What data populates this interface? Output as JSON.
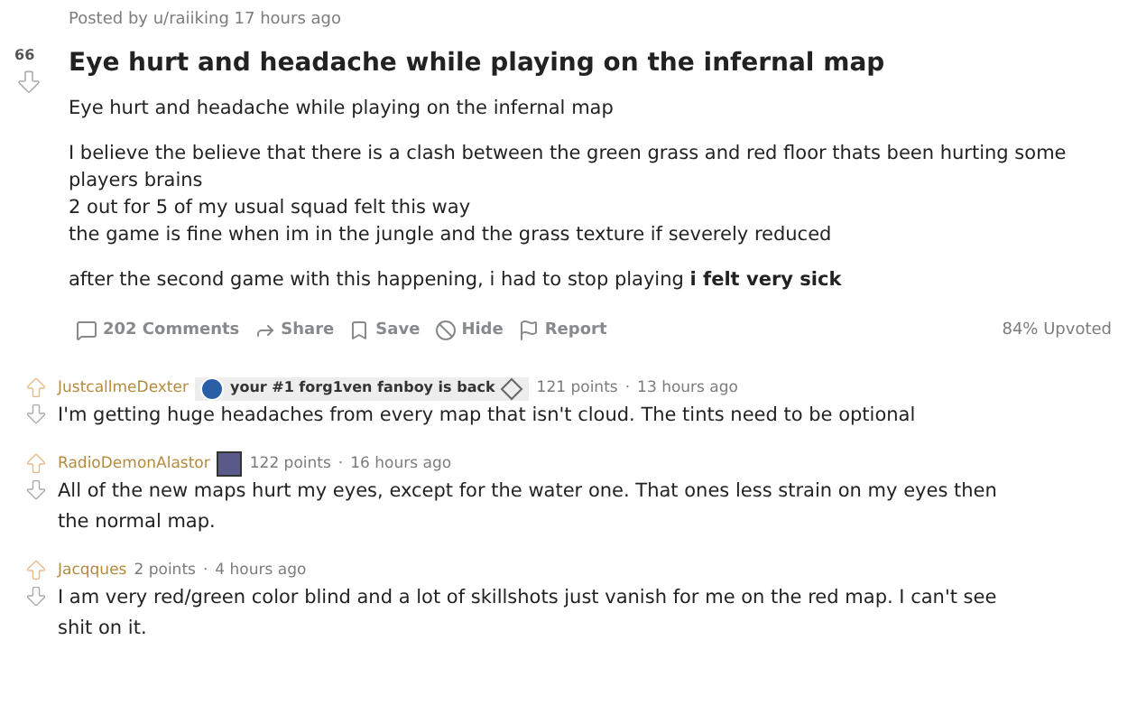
{
  "post": {
    "meta": "Posted by u/raiiking 17 hours ago",
    "score": "66",
    "title": "Eye hurt and headache while playing on the infernal map",
    "paragraphs": [
      [
        "Eye hurt and headache while playing on the infernal map"
      ],
      [
        "I believe the believe that there is a clash between the green grass and red floor thats been hurting some players brains",
        "2 out for 5 of my usual squad felt this way",
        "the game is fine when im in the jungle and the grass texture if severely reduced"
      ],
      [
        "after the second game with this happening, i had to stop playing **i felt very sick**"
      ]
    ],
    "actions": [
      {
        "kind": "comments",
        "label": "202 Comments"
      },
      {
        "kind": "share",
        "label": "Share"
      },
      {
        "kind": "save",
        "label": "Save"
      },
      {
        "kind": "hide",
        "label": "Hide"
      },
      {
        "kind": "report",
        "label": "Report"
      }
    ],
    "upvoted": "84% Upvoted"
  },
  "comments": [
    {
      "author": "JustcallmeDexter",
      "flair": "your #1 forg1ven fanboy is back",
      "has_avatar": false,
      "points": "121 points",
      "separator": "·",
      "time": "13 hours ago",
      "text": "I'm getting huge headaches from every map that isn't cloud. The tints need to be optional"
    },
    {
      "author": "RadioDemonAlastor",
      "has_avatar": true,
      "points": "122 points",
      "separator": "·",
      "time": "16 hours ago",
      "text": "All of the new maps hurt my eyes, except for the water one. That ones less strain on my eyes then the normal map."
    },
    {
      "author": "Jacqques",
      "has_avatar": false,
      "points": "2 points",
      "separator": "·",
      "time": "4 hours ago",
      "text": "I am very red/green color blind and a lot of skillshots just vanish for me on the red map. I can't see shit on it."
    }
  ]
}
